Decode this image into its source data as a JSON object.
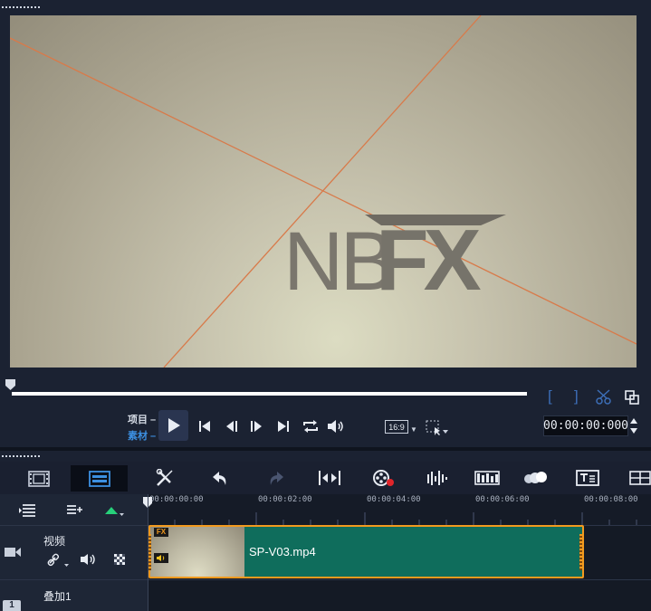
{
  "preview": {
    "watermark_text": "NBFX"
  },
  "labels": {
    "project": "项目",
    "clip": "素材"
  },
  "player": {
    "aspect_ratio": "16:9",
    "timecode": "00:00:00:000"
  },
  "toolbar": {
    "icons": [
      "storyboard-view-icon",
      "timeline-view-icon",
      "toolbox-icon",
      "undo-icon",
      "redo-icon",
      "fit-timeline-icon",
      "record-capture-icon",
      "audio-mixer-icon",
      "auto-music-icon",
      "motion-tracking-icon",
      "subtitle-editor-icon",
      "multi-camera-icon"
    ]
  },
  "ruler": {
    "ticks": [
      "00:00:00:00",
      "00:00:02:00",
      "00:00:04:00",
      "00:00:06:00",
      "00:00:08:00"
    ]
  },
  "tracks": [
    {
      "name": "视频"
    },
    {
      "name": "叠加1"
    }
  ],
  "clip": {
    "fx_badge": "FX",
    "name": "SP-V03.mp4"
  },
  "colors": {
    "clip_fill": "#0f6d5c",
    "clip_border": "#f29a1f",
    "accent_blue": "#3c8fe0",
    "preview_line": "#d87a4a"
  }
}
